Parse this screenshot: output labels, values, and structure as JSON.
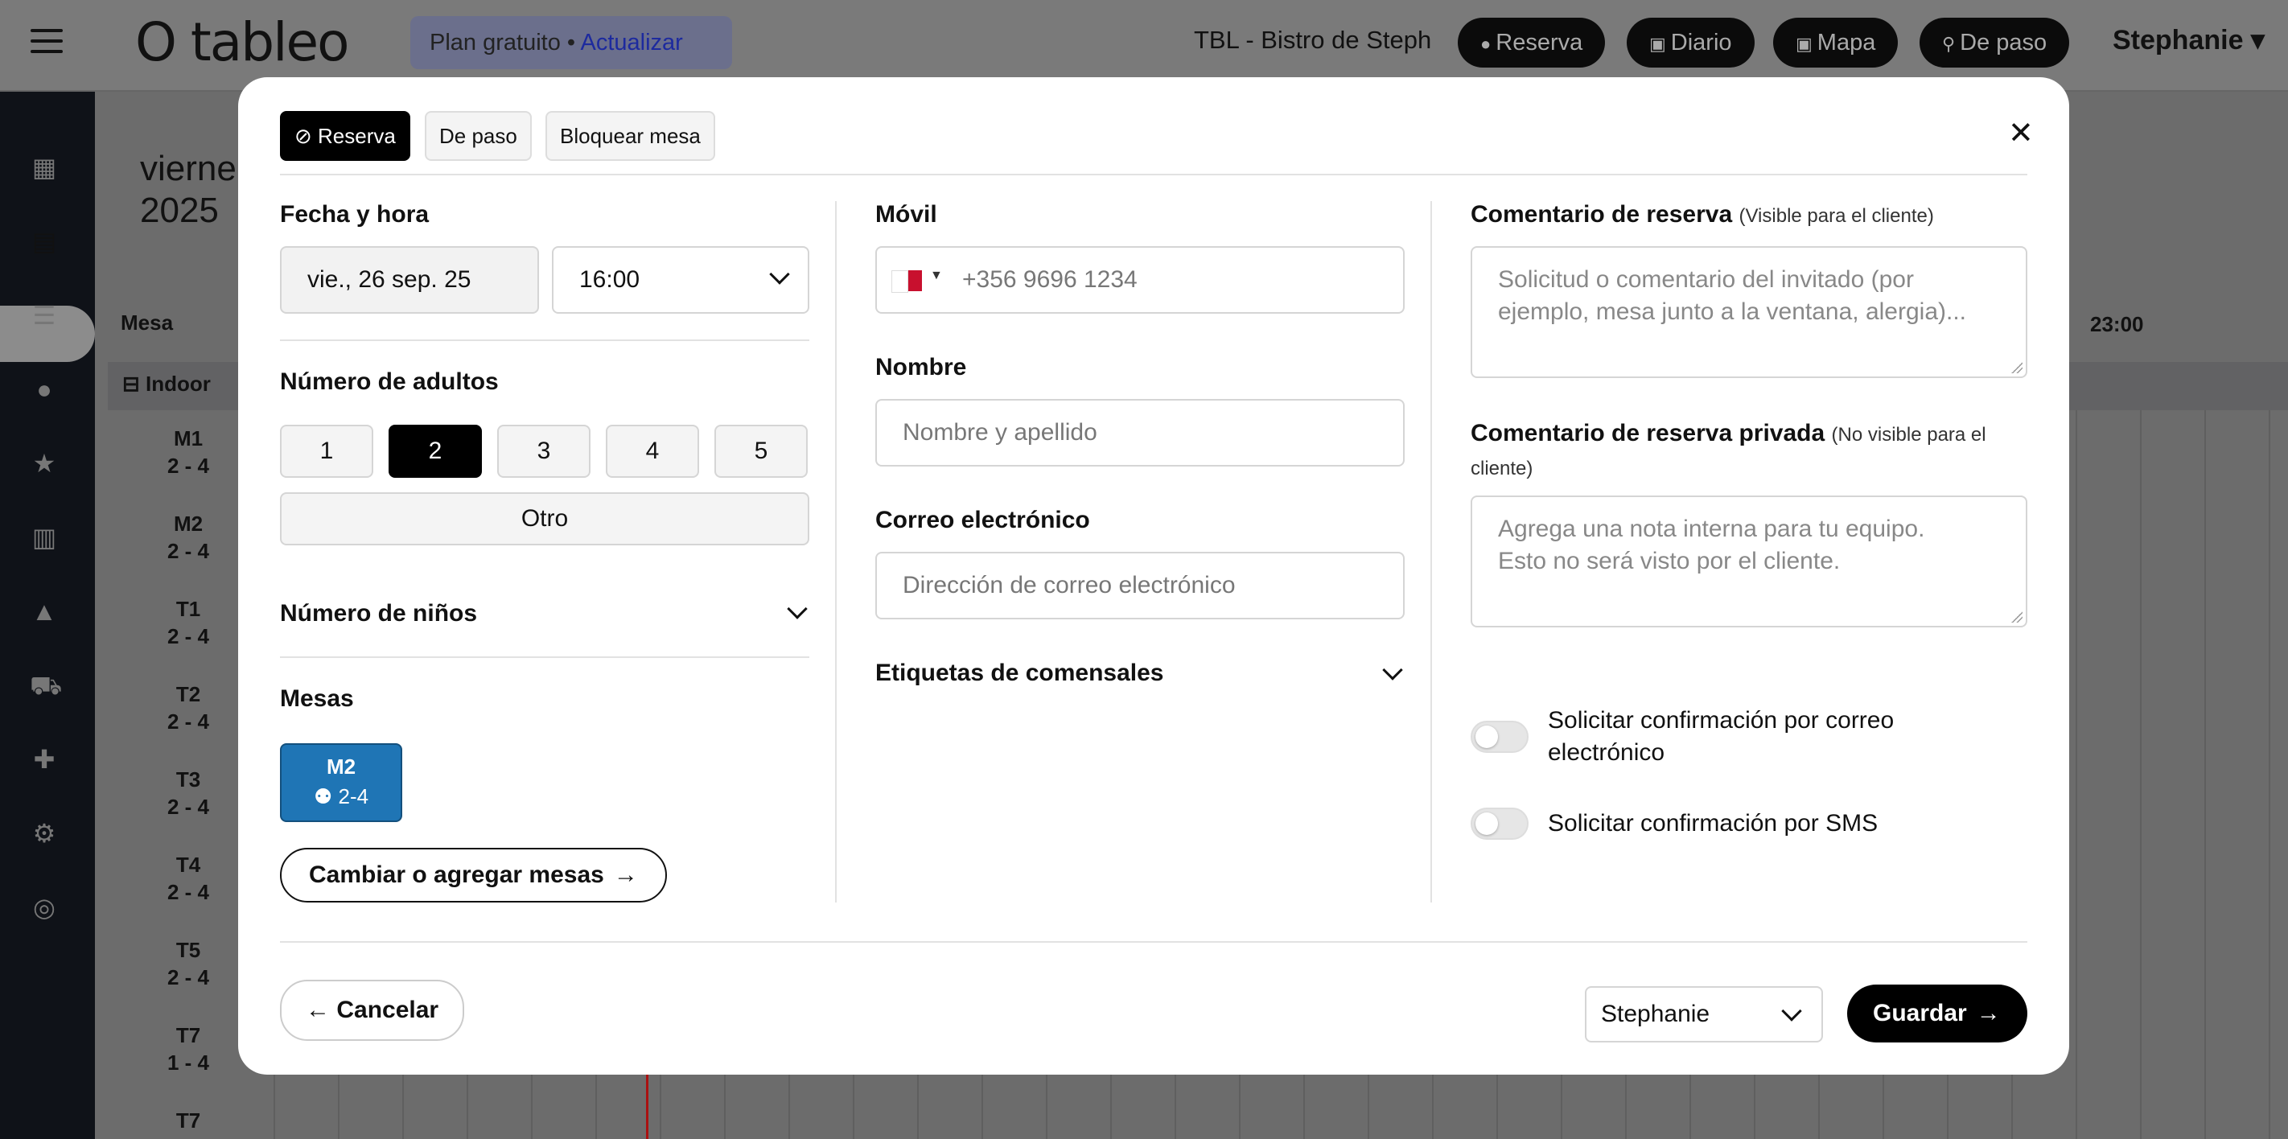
{
  "app": {
    "logo": "O tableo",
    "plan": {
      "text": "Plan gratuito • ",
      "upgrade": "Actualizar"
    },
    "restaurant": "TBL - Bistro de Steph",
    "top_buttons": [
      "Reserva",
      "Diario",
      "Mapa",
      "De paso"
    ],
    "user": "Stephanie ▾"
  },
  "background": {
    "date_line1": "vierne",
    "date_line2": "2025",
    "col_table": "Mesa",
    "area": "Indoor",
    "time_label": "23:00",
    "tables": [
      {
        "name": "M1",
        "cap": "2 - 4"
      },
      {
        "name": "M2",
        "cap": "2 - 4"
      },
      {
        "name": "T1",
        "cap": "2 - 4"
      },
      {
        "name": "T2",
        "cap": "2 - 4"
      },
      {
        "name": "T3",
        "cap": "2 - 4"
      },
      {
        "name": "T4",
        "cap": "2 - 4"
      },
      {
        "name": "T5",
        "cap": "2 - 4"
      },
      {
        "name": "T7",
        "cap": "1 - 4"
      },
      {
        "name": "T7",
        "cap": ""
      }
    ]
  },
  "modal": {
    "tabs": {
      "reserva": "Reserva",
      "de_paso": "De paso",
      "bloquear": "Bloquear mesa"
    },
    "date_time": {
      "label": "Fecha y hora",
      "date": "vie., 26 sep. 25",
      "time": "16:00"
    },
    "adults": {
      "label": "Número de adultos",
      "options": [
        "1",
        "2",
        "3",
        "4",
        "5"
      ],
      "selected": "2",
      "other": "Otro"
    },
    "children": {
      "label": "Número de niños"
    },
    "tables": {
      "label": "Mesas",
      "selected_name": "M2",
      "selected_cap": "2-4",
      "change_button": "Cambiar o agregar mesas"
    },
    "phone": {
      "label": "Móvil",
      "placeholder": "+356 9696 1234"
    },
    "name": {
      "label": "Nombre",
      "placeholder": "Nombre y apellido"
    },
    "email": {
      "label": "Correo electrónico",
      "placeholder": "Dirección de correo electrónico"
    },
    "guest_tags": {
      "label": "Etiquetas de comensales"
    },
    "comment": {
      "label": "Comentario de reserva",
      "note": "(Visible para el cliente)",
      "placeholder_l1": "Solicitud o comentario del invitado (por",
      "placeholder_l2": "ejemplo, mesa junto a la ventana, alergia)..."
    },
    "private_comment": {
      "label": "Comentario de reserva privada",
      "note_l1": "(No visible para el",
      "note_l2": "cliente)",
      "placeholder_l1": "Agrega una nota interna para tu equipo.",
      "placeholder_l2": "Esto no será visto por el cliente."
    },
    "email_confirm": {
      "label_l1": "Solicitar confirmación por correo",
      "label_l2": "electrónico",
      "enabled": false
    },
    "sms_confirm": {
      "label": "Solicitar confirmación por SMS",
      "enabled": false
    },
    "cancel": "Cancelar",
    "staff": "Stephanie",
    "save": "Guardar"
  },
  "colors": {
    "accent": "#000000",
    "table_selected": "#1f75b5",
    "overlay": "#6f6f6f"
  }
}
